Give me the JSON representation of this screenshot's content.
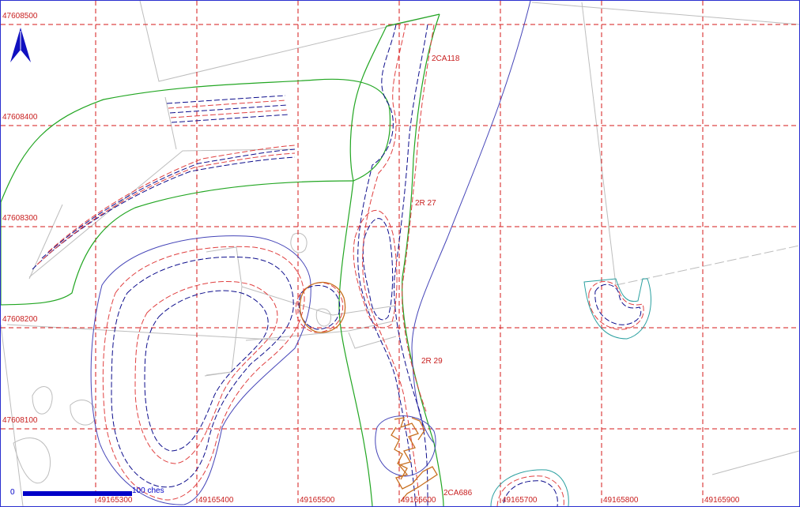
{
  "colors": {
    "grid": "#d51a1a",
    "label": "#c81e1e",
    "north_arrow": "#1010c0",
    "parcel": "#bdbdbd",
    "boundary_green": "#22a622",
    "contour_blue": "#0d0d8c",
    "contour_red": "#e04040",
    "outline_blue": "#4545b8",
    "orange": "#c87020",
    "teal": "#2aa0a0",
    "scale": "#0000c8"
  },
  "north_arrow": {
    "icon": "north-arrow-icon"
  },
  "grid": {
    "northing_labels": [
      "47608500",
      "47608400",
      "47608300",
      "47608200",
      "47608100"
    ],
    "easting_labels": [
      "49165300",
      "49165400",
      "49165500",
      "49165600",
      "49165700",
      "49165800",
      "49165900"
    ]
  },
  "features": [
    {
      "label": "2CA118"
    },
    {
      "label": "2R 27"
    },
    {
      "label": "2R 29"
    },
    {
      "label": "2CA686"
    }
  ],
  "scale_bar": {
    "zero": "0",
    "text": "100 ches",
    "fill_fraction": 1.0
  }
}
